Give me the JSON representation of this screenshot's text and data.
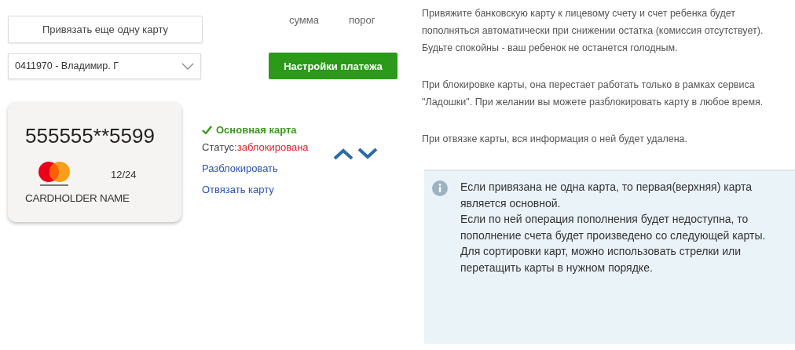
{
  "add_card_button": "Привязать еще одну карту",
  "column_headers": [
    "сумма",
    "порог"
  ],
  "account_select": {
    "value": "0411970 - Владимир. Г"
  },
  "payment_settings_button": "Настройки платежа",
  "cards": [
    {
      "number": "555555**5599",
      "expiry": "12/24",
      "holder": "CARDHOLDER NAME",
      "primary": true,
      "primary_label": "Основная карта",
      "status_label": "Статус:",
      "status": "заблокирована",
      "blocked": true,
      "unblock_link": "Разблокировать",
      "unlink_link": "Отвязать карту"
    }
  ],
  "help_paragraphs": [
    "Привяжите банковскую карту к лицевому счету и счет ребенка будет пополняться автоматически при снижении остатка (комиссия отсутствует). Будьте спокойны - ваш ребенок не останется голодным.",
    "При блокировке карты, она перестает работать только в рамках сервиса \"Ладошки\". При желании вы можете разблокировать карту в любое время.",
    "При отвязке карты, вся информация о ней будет удалена."
  ],
  "info_box": {
    "lines": [
      "Если привязана не одна карта, то первая(верхняя) карта является основной.",
      "Если по ней операция пополнения будет недоступна, то пополнение счета будет произведено со следующей карты.",
      "Для сортировки карт, можно использовать стрелки или перетащить карты в нужном порядке."
    ]
  }
}
